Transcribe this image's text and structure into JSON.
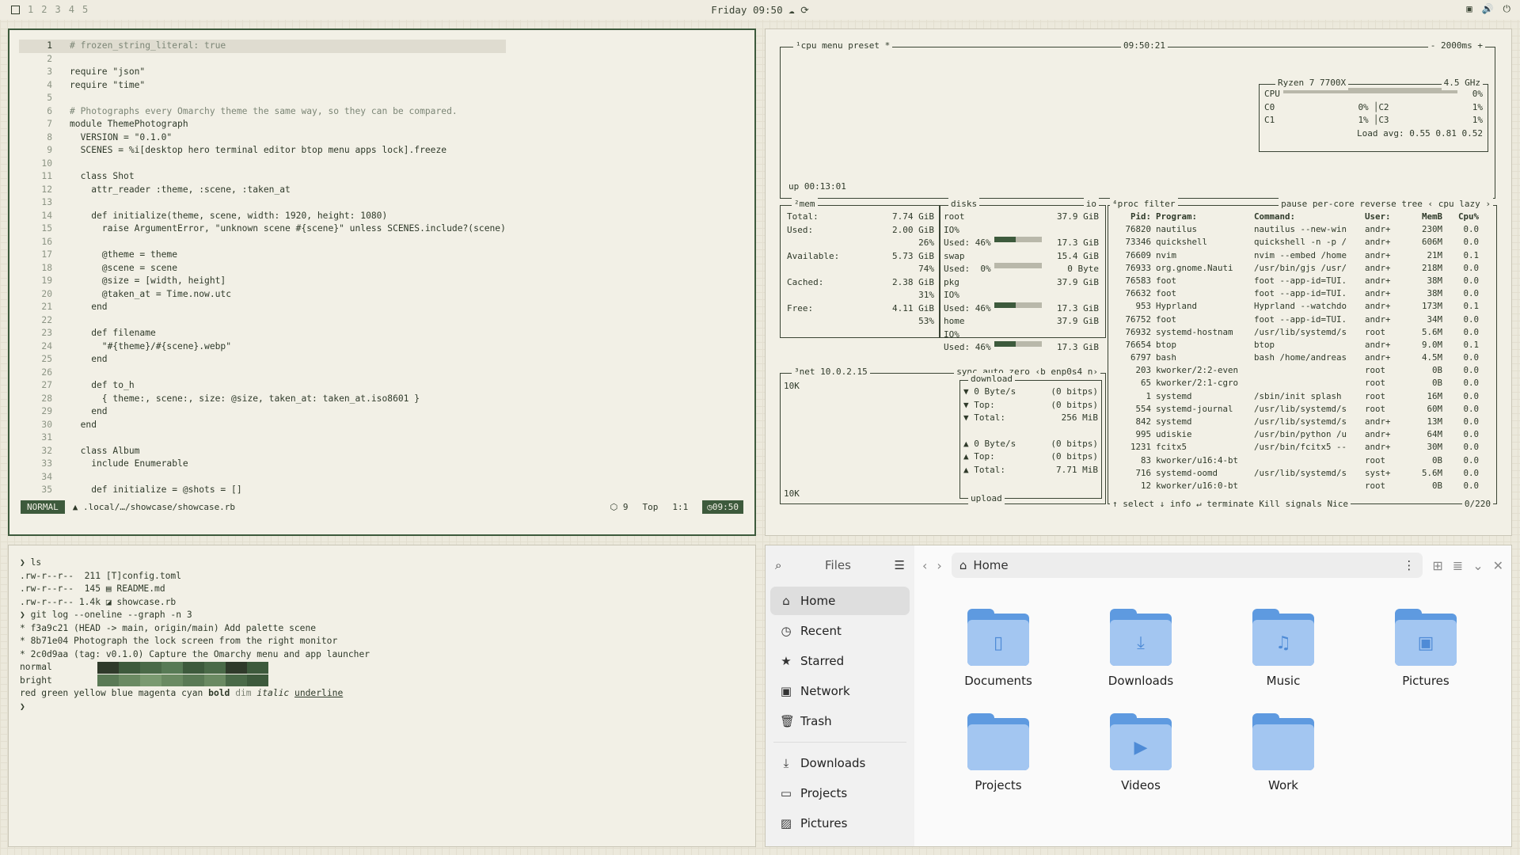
{
  "topbar": {
    "workspaces": [
      "1",
      "2",
      "3",
      "4",
      "5"
    ],
    "clock": "Friday 09:50",
    "tray": [
      "▣",
      "🔊",
      "⏻"
    ]
  },
  "editor": {
    "lines": [
      {
        "n": "1",
        "t": "# frozen_string_literal: true"
      },
      {
        "n": "2",
        "t": ""
      },
      {
        "n": "3",
        "t": "require \"json\""
      },
      {
        "n": "4",
        "t": "require \"time\""
      },
      {
        "n": "5",
        "t": ""
      },
      {
        "n": "6",
        "t": "# Photographs every Omarchy theme the same way, so they can be compared."
      },
      {
        "n": "7",
        "t": "module ThemePhotograph"
      },
      {
        "n": "8",
        "t": "  VERSION = \"0.1.0\""
      },
      {
        "n": "9",
        "t": "  SCENES = %i[desktop hero terminal editor btop menu apps lock].freeze"
      },
      {
        "n": "10",
        "t": ""
      },
      {
        "n": "11",
        "t": "  class Shot"
      },
      {
        "n": "12",
        "t": "    attr_reader :theme, :scene, :taken_at"
      },
      {
        "n": "13",
        "t": ""
      },
      {
        "n": "14",
        "t": "    def initialize(theme, scene, width: 1920, height: 1080)"
      },
      {
        "n": "15",
        "t": "      raise ArgumentError, \"unknown scene #{scene}\" unless SCENES.include?(scene)"
      },
      {
        "n": "16",
        "t": ""
      },
      {
        "n": "17",
        "t": "      @theme = theme"
      },
      {
        "n": "18",
        "t": "      @scene = scene"
      },
      {
        "n": "19",
        "t": "      @size = [width, height]"
      },
      {
        "n": "20",
        "t": "      @taken_at = Time.now.utc"
      },
      {
        "n": "21",
        "t": "    end"
      },
      {
        "n": "22",
        "t": ""
      },
      {
        "n": "23",
        "t": "    def filename"
      },
      {
        "n": "24",
        "t": "      \"#{theme}/#{scene}.webp\""
      },
      {
        "n": "25",
        "t": "    end"
      },
      {
        "n": "26",
        "t": ""
      },
      {
        "n": "27",
        "t": "    def to_h"
      },
      {
        "n": "28",
        "t": "      { theme:, scene:, size: @size, taken_at: taken_at.iso8601 }"
      },
      {
        "n": "29",
        "t": "    end"
      },
      {
        "n": "30",
        "t": "  end"
      },
      {
        "n": "31",
        "t": ""
      },
      {
        "n": "32",
        "t": "  class Album"
      },
      {
        "n": "33",
        "t": "    include Enumerable"
      },
      {
        "n": "34",
        "t": ""
      },
      {
        "n": "35",
        "t": "    def initialize = @shots = []"
      }
    ],
    "status": {
      "mode": "NORMAL",
      "path": ".local/…/showcase/showcase.rb",
      "count": "9",
      "pos": "Top",
      "cursor": "1:1",
      "time": "09:50"
    }
  },
  "btop": {
    "cpu": {
      "tag": "¹cpu",
      "menu": "menu",
      "preset": "preset *",
      "time": "09:50:21",
      "interval": "- 2000ms +",
      "model": "Ryzen 7 7700X",
      "freq": "4.5 GHz",
      "total_label": "CPU",
      "total": "0%",
      "cores": [
        {
          "n": "C0",
          "v": "0%",
          "fill": 0.0
        },
        {
          "n": "C2",
          "v": "1%",
          "fill": 0.01
        },
        {
          "n": "C1",
          "v": "1%",
          "fill": 0.01
        },
        {
          "n": "C3",
          "v": "1%",
          "fill": 0.01
        }
      ],
      "load": "Load avg: 0.55 0.81 0.52",
      "uptime": "up 00:13:01"
    },
    "mem": {
      "tag": "²mem",
      "disks_tag": "disks",
      "io": "io",
      "rows": [
        {
          "k": "Total:",
          "v": "7.74 GiB"
        },
        {
          "k": "Used:",
          "v": "2.00 GiB"
        },
        {
          "k": "",
          "v": "26%"
        },
        {
          "k": "Available:",
          "v": "5.73 GiB"
        },
        {
          "k": "",
          "v": "74%"
        },
        {
          "k": "Cached:",
          "v": "2.38 GiB"
        },
        {
          "k": "",
          "v": "31%"
        },
        {
          "k": "Free:",
          "v": "4.11 GiB"
        },
        {
          "k": "",
          "v": "53%"
        }
      ],
      "disks": [
        {
          "name": "root",
          "size": "37.9 GiB",
          "io": "IO%",
          "used": "Used: 46%",
          "used_fill": 0.46,
          "val": "17.3 GiB"
        },
        {
          "name": "swap",
          "size": "15.4 GiB",
          "io": "",
          "used": "Used:  0%",
          "used_fill": 0.0,
          "val": "0 Byte"
        },
        {
          "name": "pkg",
          "size": "37.9 GiB",
          "io": "IO%",
          "used": "Used: 46%",
          "used_fill": 0.46,
          "val": "17.3 GiB"
        },
        {
          "name": "home",
          "size": "37.9 GiB",
          "io": "IO%",
          "used": "Used: 46%",
          "used_fill": 0.46,
          "val": "17.3 GiB"
        }
      ]
    },
    "net": {
      "tag": "³net",
      "ip": "10.0.2.15",
      "opts": "sync auto zero ‹b enp0s4 n›",
      "scale_top": "10K",
      "scale_bot": "10K",
      "download": "download",
      "upload": "upload",
      "down": [
        {
          "k": "▼ 0 Byte/s",
          "v": "(0 bitps)"
        },
        {
          "k": "▼ Top:",
          "v": "(0 bitps)"
        },
        {
          "k": "▼ Total:",
          "v": "256 MiB"
        }
      ],
      "up": [
        {
          "k": "▲ 0 Byte/s",
          "v": "(0 bitps)"
        },
        {
          "k": "▲ Top:",
          "v": "(0 bitps)"
        },
        {
          "k": "▲ Total:",
          "v": "7.71 MiB"
        }
      ]
    },
    "proc": {
      "tag": "⁴proc",
      "filter": "filter",
      "opts": "pause per-core reverse tree ‹ cpu lazy ›",
      "headers": [
        "Pid:",
        "Program:",
        "Command:",
        "User:",
        "MemB",
        "Cpu%"
      ],
      "rows": [
        [
          "76820",
          "nautilus",
          "nautilus --new-win",
          "andr+",
          "230M",
          "0.0"
        ],
        [
          "73346",
          "quickshell",
          "quickshell -n -p /",
          "andr+",
          "606M",
          "0.0"
        ],
        [
          "76609",
          "nvim",
          "nvim --embed /home",
          "andr+",
          "21M",
          "0.1"
        ],
        [
          "76933",
          "org.gnome.Nauti",
          "/usr/bin/gjs /usr/",
          "andr+",
          "218M",
          "0.0"
        ],
        [
          "76583",
          "foot",
          "foot --app-id=TUI.",
          "andr+",
          "38M",
          "0.0"
        ],
        [
          "76632",
          "foot",
          "foot --app-id=TUI.",
          "andr+",
          "38M",
          "0.0"
        ],
        [
          "953",
          "Hyprland",
          "Hyprland --watchdo",
          "andr+",
          "173M",
          "0.1"
        ],
        [
          "76752",
          "foot",
          "foot --app-id=TUI.",
          "andr+",
          "34M",
          "0.0"
        ],
        [
          "76932",
          "systemd-hostnam",
          "/usr/lib/systemd/s",
          "root",
          "5.6M",
          "0.0"
        ],
        [
          "76654",
          "btop",
          "btop",
          "andr+",
          "9.0M",
          "0.1"
        ],
        [
          "6797",
          "bash",
          "bash /home/andreas",
          "andr+",
          "4.5M",
          "0.0"
        ],
        [
          "203",
          "kworker/2:2-even",
          "",
          "root",
          "0B",
          "0.0"
        ],
        [
          "65",
          "kworker/2:1-cgro",
          "",
          "root",
          "0B",
          "0.0"
        ],
        [
          "1",
          "systemd",
          "/sbin/init splash",
          "root",
          "16M",
          "0.0"
        ],
        [
          "554",
          "systemd-journal",
          "/usr/lib/systemd/s",
          "root",
          "60M",
          "0.0"
        ],
        [
          "842",
          "systemd",
          "/usr/lib/systemd/s",
          "andr+",
          "13M",
          "0.0"
        ],
        [
          "995",
          "udiskie",
          "/usr/bin/python /u",
          "andr+",
          "64M",
          "0.0"
        ],
        [
          "1231",
          "fcitx5",
          "/usr/bin/fcitx5 --",
          "andr+",
          "30M",
          "0.0"
        ],
        [
          "83",
          "kworker/u16:4-bt",
          "",
          "root",
          "0B",
          "0.0"
        ],
        [
          "716",
          "systemd-oomd",
          "/usr/lib/systemd/s",
          "syst+",
          "5.6M",
          "0.0"
        ],
        [
          "12",
          "kworker/u16:0-bt",
          "",
          "root",
          "0B",
          "0.0"
        ]
      ],
      "footer": "↑ select ↓ info ↵ terminate Kill signals Nice",
      "count": "0/220"
    }
  },
  "term": {
    "lines": [
      "❯ ls",
      ".rw-r--r--  211 [T]config.toml",
      ".rw-r--r--  145 ▤ README.md",
      ".rw-r--r-- 1.4k ◪ showcase.rb",
      "❯ git log --oneline --graph -n 3",
      "* f3a9c21 (HEAD -> main, origin/main) Add palette scene",
      "* 8b71e04 Photograph the lock screen from the right monitor",
      "* 2c0d9aa (tag: v0.1.0) Capture the Omarchy menu and app launcher"
    ],
    "normal_label": "normal",
    "bright_label": "bright",
    "normal_colors": [
      "#2f3a2a",
      "#3d5a3c",
      "#4a6a48",
      "#577a55",
      "#3d5a3c",
      "#4a6a48",
      "#2f3a2a",
      "#3d5a3c"
    ],
    "bright_colors": [
      "#5a7a55",
      "#6a8a62",
      "#7a9a70",
      "#6a8a62",
      "#5a7a55",
      "#6a8a62",
      "#4a6a48",
      "#3d5a3c"
    ],
    "styles": [
      "red",
      "green",
      "yellow",
      "blue",
      "magenta",
      "cyan",
      "bold",
      "dim",
      "italic",
      "underline"
    ],
    "prompt": "❯"
  },
  "files": {
    "title": "Files",
    "sidebar": [
      {
        "label": "Home",
        "icon": "home-icon",
        "glyph": "⌂"
      },
      {
        "label": "Recent",
        "icon": "clock-icon",
        "glyph": "◷"
      },
      {
        "label": "Starred",
        "icon": "star-icon",
        "glyph": "★"
      },
      {
        "label": "Network",
        "icon": "network-icon",
        "glyph": "▣"
      },
      {
        "label": "Trash",
        "icon": "trash-icon",
        "glyph": "🗑"
      }
    ],
    "bookmarks": [
      {
        "label": "Downloads",
        "icon": "download-icon",
        "glyph": "⤓"
      },
      {
        "label": "Projects",
        "icon": "folder-icon",
        "glyph": "▭"
      },
      {
        "label": "Pictures",
        "icon": "image-icon",
        "glyph": "▨"
      }
    ],
    "location": "Home",
    "folders": [
      {
        "label": "Documents",
        "icon": "document-icon",
        "glyph": "▯"
      },
      {
        "label": "Downloads",
        "icon": "download-icon",
        "glyph": "⤓"
      },
      {
        "label": "Music",
        "icon": "music-icon",
        "glyph": "♫"
      },
      {
        "label": "Pictures",
        "icon": "image-icon",
        "glyph": "▣"
      },
      {
        "label": "Projects",
        "icon": "",
        "glyph": ""
      },
      {
        "label": "Videos",
        "icon": "video-icon",
        "glyph": "▶"
      },
      {
        "label": "Work",
        "icon": "",
        "glyph": ""
      }
    ]
  }
}
